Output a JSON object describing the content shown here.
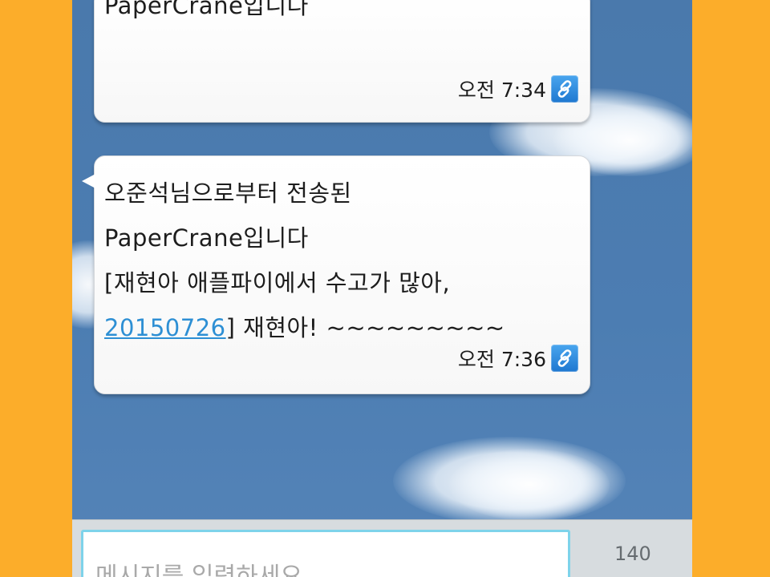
{
  "chat": {
    "messages": [
      {
        "lines": [
          "PaperCrane입니다"
        ],
        "time": "오전 7:34",
        "icon": "link-icon"
      },
      {
        "lines": [
          "오준석님으로부터 전송된",
          "PaperCrane입니다",
          "[재현아 애플파이에서 수고가 많아,"
        ],
        "link_text": "20150726",
        "after_link": "] 재현아! ~~~~~~~~~",
        "time": "오전 7:36",
        "icon": "link-icon"
      }
    ]
  },
  "composer": {
    "placeholder": "메시지를 입력하세요",
    "char_count": "140"
  },
  "colors": {
    "frame": "#fcad2a",
    "chat_background": "#4a79ac",
    "input_border": "#7ed3ea",
    "link": "#2d8fd4",
    "link_icon": "#2a87dc"
  }
}
